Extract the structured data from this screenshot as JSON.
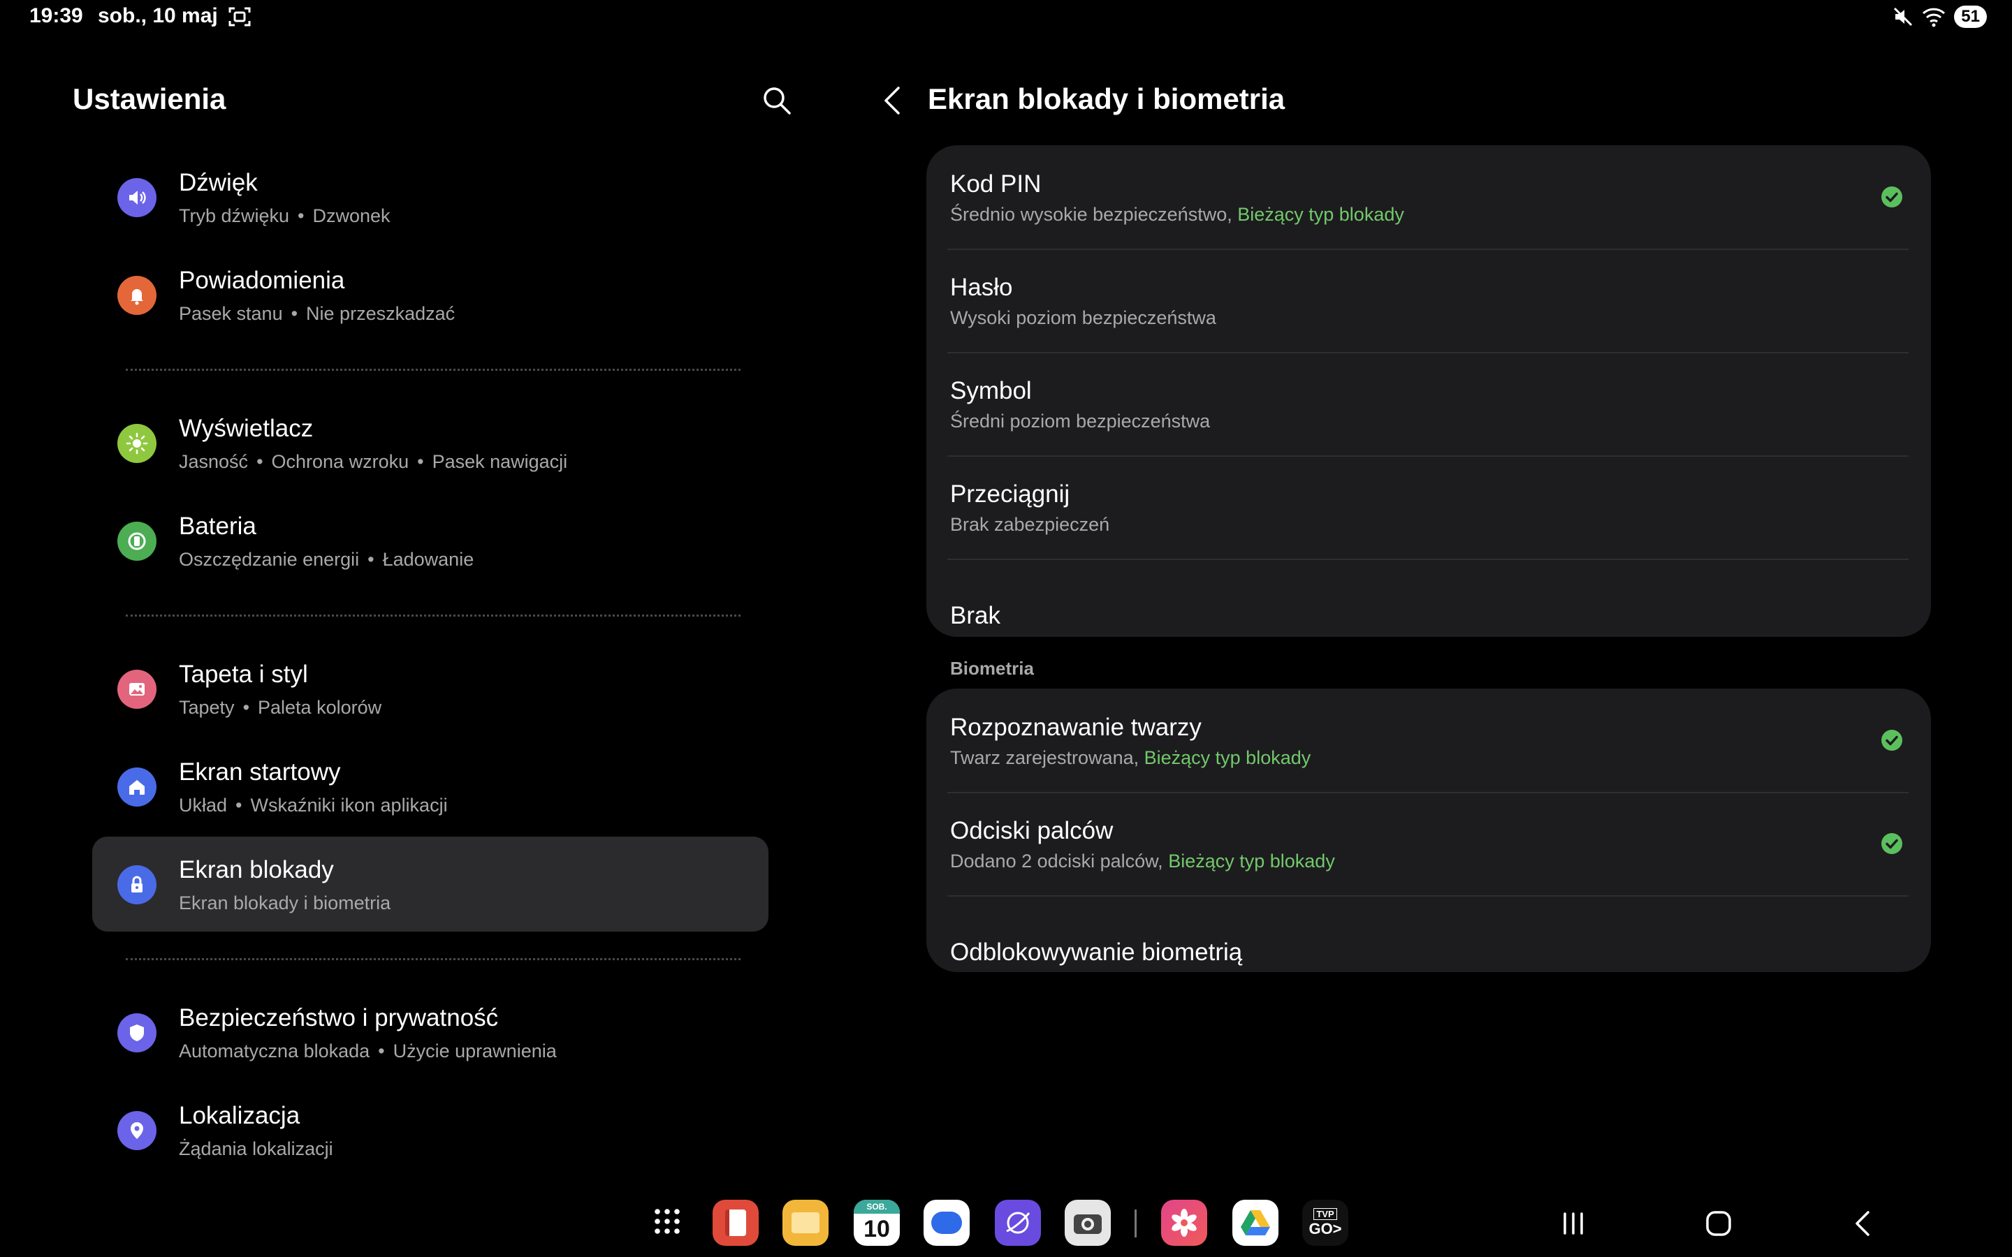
{
  "status": {
    "time": "19:39",
    "date": "sob., 10 maj",
    "battery": "51"
  },
  "left": {
    "title": "Ustawienia",
    "items": [
      {
        "title": "Dźwięk",
        "subs": [
          "Tryb dźwięku",
          "Dzwonek"
        ],
        "icon": "speaker-icon",
        "color": "#6b63e8"
      },
      {
        "title": "Powiadomienia",
        "subs": [
          "Pasek stanu",
          "Nie przeszkadzać"
        ],
        "icon": "bell-icon",
        "color": "#e4673a"
      },
      {
        "title": "Wyświetlacz",
        "subs": [
          "Jasność",
          "Ochrona wzroku",
          "Pasek nawigacji"
        ],
        "icon": "sun-icon",
        "color": "#8fc83e"
      },
      {
        "title": "Bateria",
        "subs": [
          "Oszczędzanie energii",
          "Ładowanie"
        ],
        "icon": "battery-icon",
        "color": "#4cad53"
      },
      {
        "title": "Tapeta i styl",
        "subs": [
          "Tapety",
          "Paleta kolorów"
        ],
        "icon": "image-icon",
        "color": "#e3657d"
      },
      {
        "title": "Ekran startowy",
        "subs": [
          "Układ",
          "Wskaźniki ikon aplikacji"
        ],
        "icon": "home-icon",
        "color": "#4a6be8"
      },
      {
        "title": "Ekran blokady",
        "subs": [
          "Ekran blokady i biometria"
        ],
        "icon": "lock-icon",
        "color": "#4a6be8"
      },
      {
        "title": "Bezpieczeństwo i prywatność",
        "subs": [
          "Automatyczna blokada",
          "Użycie uprawnienia"
        ],
        "icon": "shield-icon",
        "color": "#6b63e8"
      },
      {
        "title": "Lokalizacja",
        "subs": [
          "Żądania lokalizacji"
        ],
        "icon": "location-pin-icon",
        "color": "#6b63e8"
      }
    ]
  },
  "right": {
    "title": "Ekran blokady i biometria",
    "lock_types": [
      {
        "title": "Kod PIN",
        "sub": "Średnio wysokie bezpieczeństwo,",
        "current": "Bieżący typ blokady",
        "checked": true
      },
      {
        "title": "Hasło",
        "sub": "Wysoki poziom bezpieczeństwa",
        "current": "",
        "checked": false
      },
      {
        "title": "Symbol",
        "sub": "Średni poziom bezpieczeństwa",
        "current": "",
        "checked": false
      },
      {
        "title": "Przeciągnij",
        "sub": "Brak zabezpieczeń",
        "current": "",
        "checked": false
      },
      {
        "title": "Brak",
        "sub": "",
        "current": "",
        "checked": false
      }
    ],
    "biometrics_label": "Biometria",
    "biometrics": [
      {
        "title": "Rozpoznawanie twarzy",
        "sub": "Twarz zarejestrowana,",
        "current": "Bieżący typ blokady",
        "checked": true
      },
      {
        "title": "Odciski palców",
        "sub": "Dodano 2 odciski palców,",
        "current": "Bieżący typ blokady",
        "checked": true
      },
      {
        "title": "Odblokowywanie biometrią",
        "sub": "",
        "current": "",
        "checked": false
      }
    ]
  },
  "taskbar": {
    "apps": [
      "apps-grid-icon",
      "notes-app-icon",
      "files-app-icon",
      "calendar-app-icon",
      "messages-app-icon",
      "browser-app-icon",
      "camera-app-icon",
      "gallery-app-icon",
      "drive-app-icon",
      "tvp-go-app-icon"
    ],
    "calendar_day": "SOB.",
    "calendar_date": "10",
    "tvp_top": "TVP",
    "tvp_bottom": "GO>"
  }
}
